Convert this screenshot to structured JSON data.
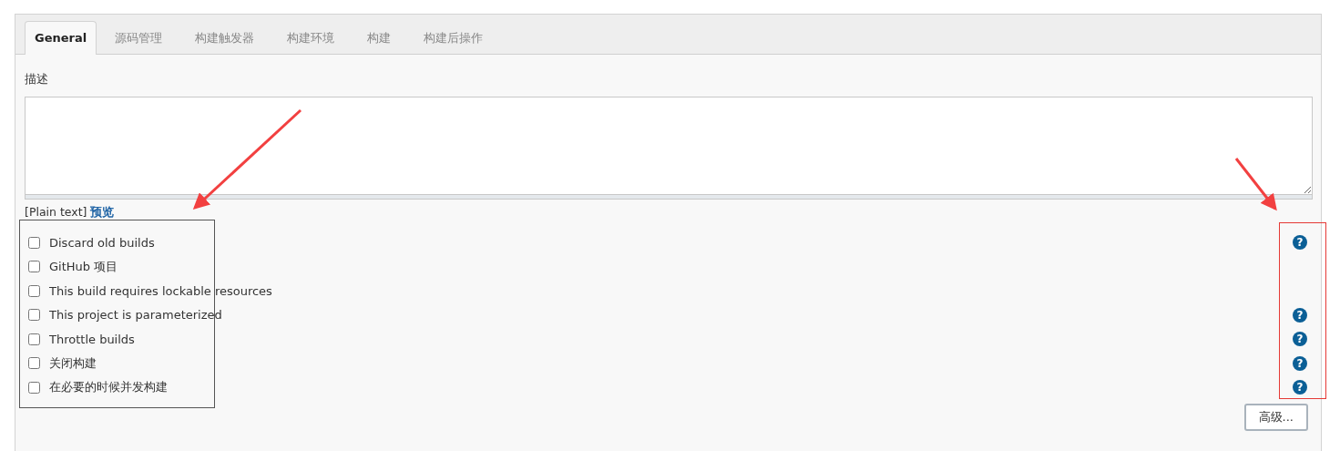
{
  "tabs": [
    {
      "label": "General",
      "selected": true
    },
    {
      "label": "源码管理",
      "selected": false
    },
    {
      "label": "构建触发器",
      "selected": false
    },
    {
      "label": "构建环境",
      "selected": false
    },
    {
      "label": "构建",
      "selected": false
    },
    {
      "label": "构建后操作",
      "selected": false
    }
  ],
  "description": {
    "label": "描述",
    "format": "[Plain text]",
    "preview_link": "预览"
  },
  "options": [
    {
      "label": "Discard old builds",
      "checked": false,
      "help": "?"
    },
    {
      "label": "GitHub 项目",
      "checked": false
    },
    {
      "label": "This build requires lockable resources",
      "checked": false
    },
    {
      "label": "This project is parameterized",
      "checked": false,
      "help": "?"
    },
    {
      "label": "Throttle builds",
      "checked": false,
      "help": "?"
    },
    {
      "label": "关闭构建",
      "checked": false,
      "help": "?"
    },
    {
      "label": "在必要的时候并发构建",
      "checked": false,
      "help": "?"
    }
  ],
  "advanced_button": "高级..."
}
